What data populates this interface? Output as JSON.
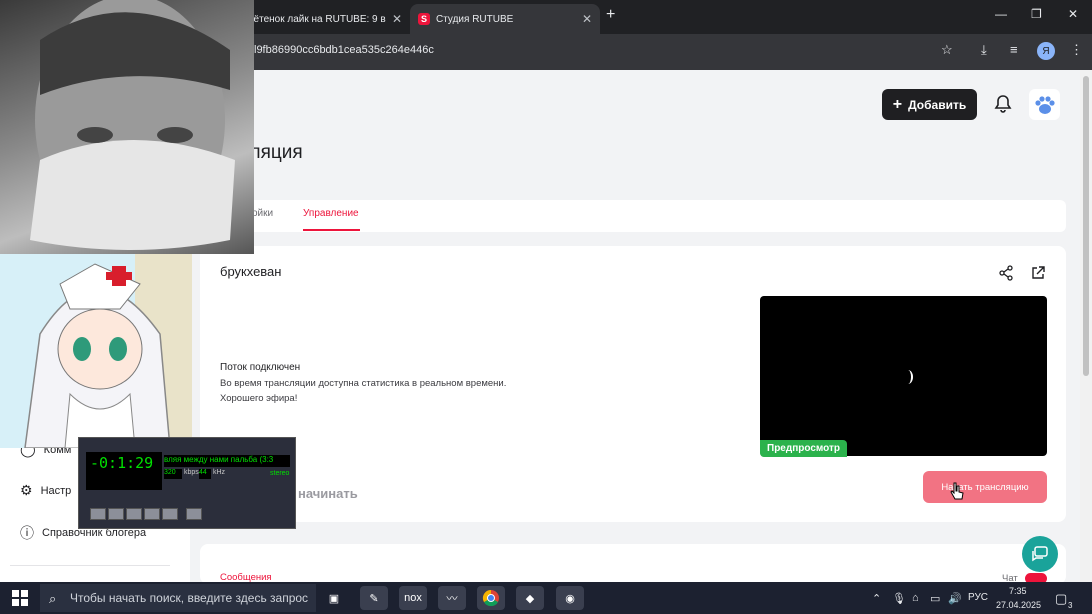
{
  "browser": {
    "tabs": [
      {
        "title": "рётенок лайк на RUTUBE: 9 ви"
      },
      {
        "title": "Студия RUTUBE"
      }
    ],
    "url": "l9fb86990cc6bdb1cea535c264e446c",
    "profile_letter": "Я"
  },
  "header": {
    "add_label": "Добавить"
  },
  "page": {
    "title": "сляция",
    "tabs": [
      {
        "label": "ойки"
      },
      {
        "label": "Управление"
      }
    ]
  },
  "stream": {
    "name": "брукхеван",
    "status_title": "Поток подключен",
    "status_desc": "Во время трансляции доступна статистика в реальном времени.",
    "status_wish": "Хорошего эфира!",
    "begin_text": "начинать",
    "preview_badge": "Предпросмотр",
    "start_button": "Начать трансляцию"
  },
  "chat": {
    "messages_tab": "Сообщения",
    "chat_label": "Чат"
  },
  "sidebar": {
    "items": [
      {
        "label": "Комм"
      },
      {
        "label": "Настр"
      },
      {
        "label": "Справочник блогера"
      }
    ]
  },
  "winamp": {
    "time": "-0:1:29",
    "title": "вляя между нами пальба (3:3",
    "kbps": "320",
    "khz": "44",
    "kbps_label": "kbps",
    "khz_label": "kHz",
    "mode": "stereo"
  },
  "taskbar": {
    "search_placeholder": "Чтобы начать поиск, введите здесь запрос",
    "lang": "РУС",
    "time": "7:35",
    "date": "27.04.2025",
    "notifications": "3"
  },
  "colors": {
    "accent": "#ed143b",
    "start_button": "#f27383",
    "preview_badge": "#2bb24c"
  }
}
